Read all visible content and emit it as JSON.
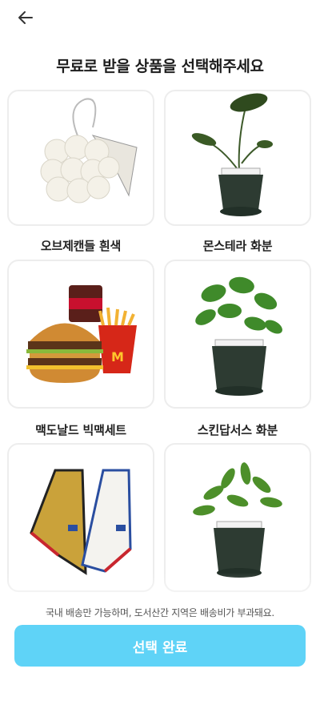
{
  "header": {
    "back_icon": "arrow-left-icon"
  },
  "title": "무료로 받을 상품을 선택해주세요",
  "products": [
    {
      "name": "오브제캔들 흰색",
      "image": "bubble-candle-image"
    },
    {
      "name": "몬스테라 화분",
      "image": "monstera-plant-image"
    },
    {
      "name": "맥도날드 빅맥세트",
      "image": "bigmac-set-image"
    },
    {
      "name": "스킨답서스 화분",
      "image": "pothos-plant-image"
    },
    {
      "name": "",
      "image": "towels-image"
    },
    {
      "name": "",
      "image": "schefflera-plant-image"
    }
  ],
  "notice": "국내 배송만 가능하며, 도서산간 지역은 배송비가 부과돼요.",
  "confirm_button": "선택 완료",
  "colors": {
    "accent": "#5fd3f7",
    "card_border": "#ededed"
  }
}
